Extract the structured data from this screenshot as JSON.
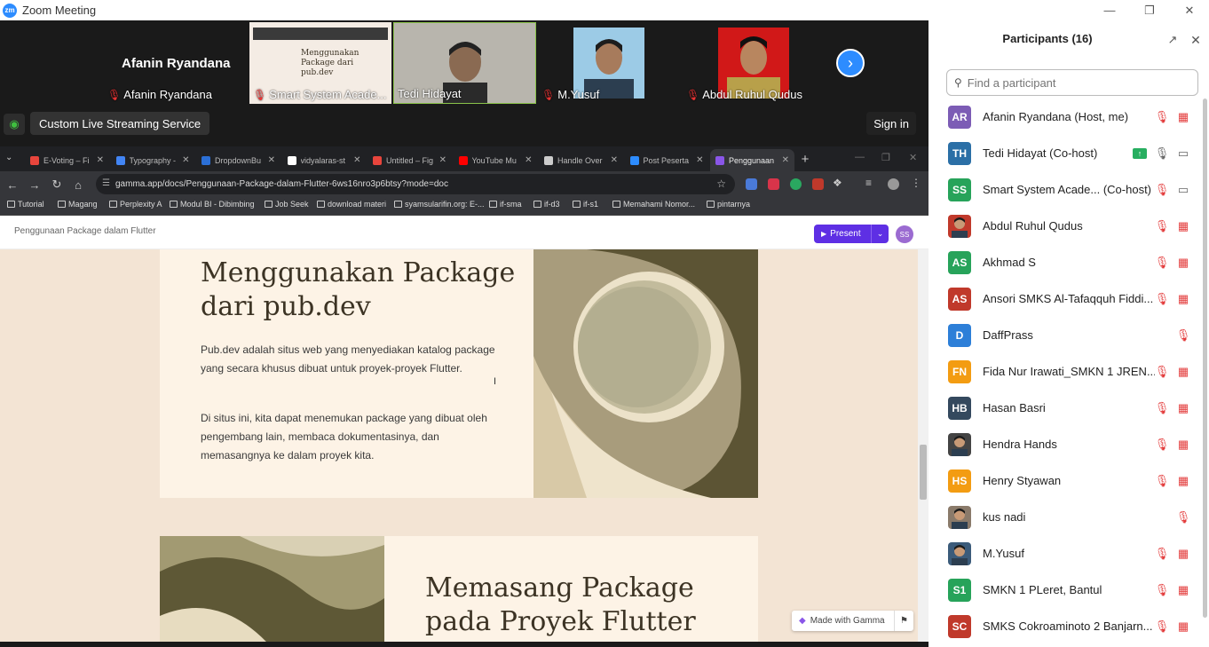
{
  "window": {
    "title": "Zoom Meeting",
    "logo": "zm"
  },
  "strip": {
    "speaker_name": "Afanin Ryandana",
    "tiles": [
      {
        "name": "Afanin Ryandana",
        "muted": true
      },
      {
        "name": "Smart System Acade...",
        "muted": true
      },
      {
        "name": "Tedi Hidayat",
        "muted": false
      },
      {
        "name": "M.Yusuf",
        "muted": true
      },
      {
        "name": "Abdul Ruhul Qudus",
        "muted": true
      }
    ]
  },
  "live": {
    "button_label": "Custom Live Streaming Service",
    "signin_label": "Sign in"
  },
  "browser": {
    "tabs": [
      {
        "title": "E-Voting – Fi",
        "color": "#e8453c"
      },
      {
        "title": "Typography -",
        "color": "#4285f4"
      },
      {
        "title": "DropdownBu",
        "color": "#2b6fd6"
      },
      {
        "title": "vidyalaras-st",
        "color": "#ffffff"
      },
      {
        "title": "Untitled – Fig",
        "color": "#e8453c"
      },
      {
        "title": "YouTube Mu",
        "color": "#ff0000"
      },
      {
        "title": "Handle Over",
        "color": "#cccccc"
      },
      {
        "title": "Post Peserta",
        "color": "#2d8cff"
      },
      {
        "title": "Penggunaan",
        "color": "#8a56e8"
      }
    ],
    "url": "gamma.app/docs/Penggunaan-Package-dalam-Flutter-6ws16nro3p6btsy?mode=doc",
    "bookmarks": [
      "Tutorial",
      "Magang",
      "Perplexity A",
      "Modul BI - Dibimbing",
      "Job Seek",
      "download materi",
      "syamsularifin.org: E-...",
      "if-sma",
      "if-d3",
      "if-s1",
      "Memahami Nomor...",
      "pintarnya"
    ]
  },
  "gamma": {
    "doc_title": "Penggunaan Package dalam Flutter",
    "present_label": "Present",
    "user_initials": "SS",
    "made_with": "Made with Gamma"
  },
  "doc": {
    "card1": {
      "heading": "Menggunakan Package dari pub.dev",
      "p1": "Pub.dev adalah situs web yang menyediakan katalog package yang secara khusus dibuat untuk proyek-proyek Flutter.",
      "p2": "Di situs ini, kita dapat menemukan package yang dibuat oleh pengembang lain, membaca dokumentasinya, dan memasangnya ke dalam proyek kita."
    },
    "card2": {
      "heading": "Memasang Package pada Proyek Flutter"
    }
  },
  "participants": {
    "title": "Participants (16)",
    "search_placeholder": "Find a participant",
    "list": [
      {
        "initials": "AR",
        "name": "Afanin Ryandana (Host, me)",
        "color": "#7c5cb5",
        "mic": "muted",
        "video": "off"
      },
      {
        "initials": "TH",
        "name": "Tedi Hidayat (Co-host)",
        "color": "#2b6fa6",
        "mic": "on",
        "video": "on",
        "sharing": true
      },
      {
        "initials": "SS",
        "name": "Smart System Acade...  (Co-host)",
        "color": "#27a35a",
        "mic": "muted",
        "video": "on"
      },
      {
        "initials": "",
        "name": "Abdul Ruhul Qudus",
        "color": "#c0392b",
        "mic": "muted",
        "video": "off",
        "photo": true
      },
      {
        "initials": "AS",
        "name": "Akhmad S",
        "color": "#27a35a",
        "mic": "muted",
        "video": "off"
      },
      {
        "initials": "AS",
        "name": "Ansori SMKS Al-Tafaqquh Fiddi...",
        "color": "#c0392b",
        "mic": "muted",
        "video": "off"
      },
      {
        "initials": "D",
        "name": "DaffPrass",
        "color": "#2d7fd8",
        "mic": "muted",
        "video": "none"
      },
      {
        "initials": "FN",
        "name": "Fida Nur Irawati_SMKN 1 JREN...",
        "color": "#f39c12",
        "mic": "muted",
        "video": "off"
      },
      {
        "initials": "HB",
        "name": "Hasan Basri",
        "color": "#34495e",
        "mic": "muted",
        "video": "off"
      },
      {
        "initials": "",
        "name": "Hendra Hands",
        "color": "#444444",
        "mic": "muted",
        "video": "off",
        "photo": true
      },
      {
        "initials": "HS",
        "name": "Henry Styawan",
        "color": "#f39c12",
        "mic": "muted",
        "video": "off"
      },
      {
        "initials": "",
        "name": "kus nadi",
        "color": "#8a7a6a",
        "mic": "muted",
        "video": "none",
        "photo": true
      },
      {
        "initials": "",
        "name": "M.Yusuf",
        "color": "#3b5b7a",
        "mic": "muted",
        "video": "off",
        "photo": true
      },
      {
        "initials": "S1",
        "name": "SMKN 1 PLeret, Bantul",
        "color": "#27a35a",
        "mic": "muted",
        "video": "off"
      },
      {
        "initials": "SC",
        "name": "SMKS Cokroaminoto 2 Banjarn...",
        "color": "#c0392b",
        "mic": "muted",
        "video": "off"
      }
    ]
  },
  "colors": {
    "zoom_blue": "#2D8CFF",
    "muted_red": "#e33b3b",
    "gamma_purple": "#5e2fe4",
    "doc_bg": "#f3e4d4"
  }
}
